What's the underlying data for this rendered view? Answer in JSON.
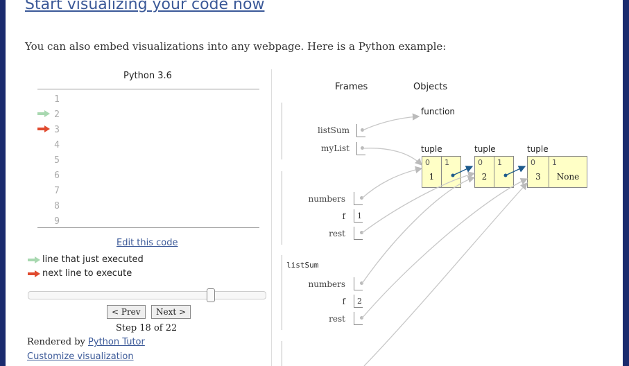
{
  "headline": "Start visualizing your code now",
  "intro": "You can also embed visualizations into any webpage. Here is a Python example:",
  "code_panel": {
    "language_title": "Python 3.6",
    "line_numbers": [
      "1",
      "2",
      "3",
      "4",
      "5",
      "6",
      "7",
      "8",
      "9"
    ],
    "just_executed_line": "2",
    "next_line": "3",
    "edit_link": "Edit this code",
    "legend_executed": "line that just executed",
    "legend_next": "next line to execute",
    "prev_button": "< Prev",
    "next_button": "Next >",
    "step_text": "Step 18 of 22",
    "slider_step": 18,
    "slider_total": 22,
    "rendered_by": "Rendered by",
    "rendered_by_link": "Python Tutor",
    "customize_link": "Customize visualization"
  },
  "viz": {
    "frames_header": "Frames",
    "objects_header": "Objects",
    "global_vars": [
      "listSum",
      "myList"
    ],
    "frame1_vars": [
      {
        "name": "numbers",
        "value": ""
      },
      {
        "name": "f",
        "value": "1"
      },
      {
        "name": "rest",
        "value": ""
      }
    ],
    "frame2_name": "listSum",
    "frame2_vars": [
      {
        "name": "numbers",
        "value": ""
      },
      {
        "name": "f",
        "value": "2"
      },
      {
        "name": "rest",
        "value": ""
      }
    ],
    "function_label": "function",
    "tuples": [
      {
        "label": "tuple",
        "indices": [
          "0",
          "1"
        ],
        "values": [
          "1",
          ""
        ]
      },
      {
        "label": "tuple",
        "indices": [
          "0",
          "1"
        ],
        "values": [
          "2",
          ""
        ]
      },
      {
        "label": "tuple",
        "indices": [
          "0",
          "1"
        ],
        "values": [
          "3",
          "None"
        ]
      }
    ]
  },
  "colors": {
    "executed_arrow": "#a8d8b0",
    "next_arrow": "#e04a2e",
    "link": "#3b5998",
    "tuple_bg": "#ffffc6",
    "frame_border": "#1a2b6e"
  }
}
